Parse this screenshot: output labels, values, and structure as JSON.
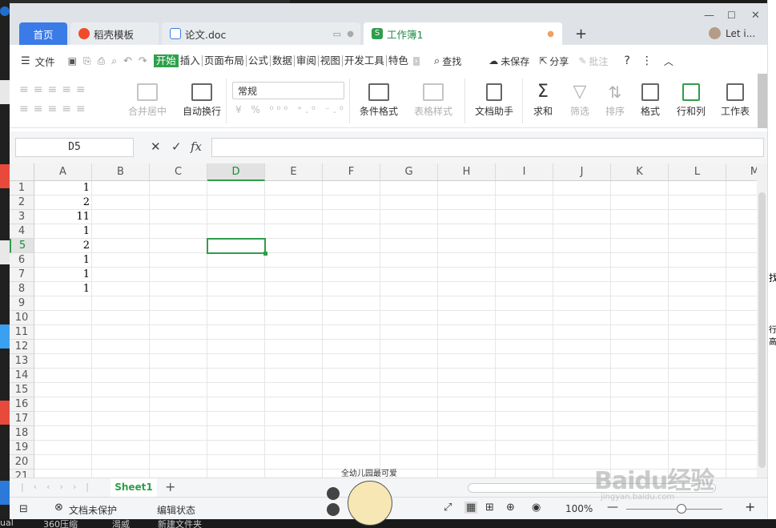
{
  "window": {
    "tabs": [
      {
        "label": "首页"
      },
      {
        "label": "稻壳模板"
      },
      {
        "label": "论文.doc"
      },
      {
        "label": "工作簿1"
      }
    ],
    "add_tab": "+",
    "user": "Let i..."
  },
  "menu": {
    "file": "文件",
    "items": [
      "开始",
      "插入",
      "页面布局",
      "公式",
      "数据",
      "审阅",
      "视图",
      "开发工具",
      "特色"
    ],
    "search": "查找",
    "unsaved": "未保存",
    "share": "分享",
    "comment": "批注"
  },
  "ribbon": {
    "merge": "合并居中",
    "wrap": "自动换行",
    "number_format": "常规",
    "cond_format": "条件格式",
    "table_style": "表格样式",
    "doc_helper": "文档助手",
    "sum": "求和",
    "filter": "筛选",
    "sort": "排序",
    "format": "格式",
    "rowcol": "行和列",
    "worksheet": "工作表"
  },
  "formula_bar": {
    "name_box": "D5",
    "fx": "fx",
    "value": ""
  },
  "sheet": {
    "columns": [
      "A",
      "B",
      "C",
      "D",
      "E",
      "F",
      "G",
      "H",
      "I",
      "J",
      "K",
      "L",
      "M"
    ],
    "selected_col": "D",
    "selected_row": 5,
    "rows": [
      "1",
      "2",
      "3",
      "4",
      "5",
      "6",
      "7",
      "8",
      "9",
      "10",
      "11",
      "12",
      "13",
      "14",
      "15",
      "16",
      "17",
      "18",
      "19",
      "20",
      "21"
    ],
    "col_a_values": [
      "1",
      "2",
      "11",
      "1",
      "2",
      "1",
      "1",
      "1"
    ]
  },
  "sheetbar": {
    "sheet_name": "Sheet1",
    "add": "+"
  },
  "status": {
    "protect": "文档未保护",
    "mode": "编辑状态",
    "zoom": "100%"
  },
  "overlay": {
    "mascot_caption": "全幼儿园最可爱",
    "watermark": "Baidu经验",
    "watermark_url": "jingyan.baidu.com"
  },
  "desktop": {
    "right_texts": [
      "找",
      "行高"
    ],
    "bottom_texts": [
      "ual",
      "360压缩",
      "渴威",
      "新建文件夹"
    ]
  },
  "colors": {
    "accent_green": "#2e9e4a",
    "home_tab_blue": "#3b7be8"
  }
}
